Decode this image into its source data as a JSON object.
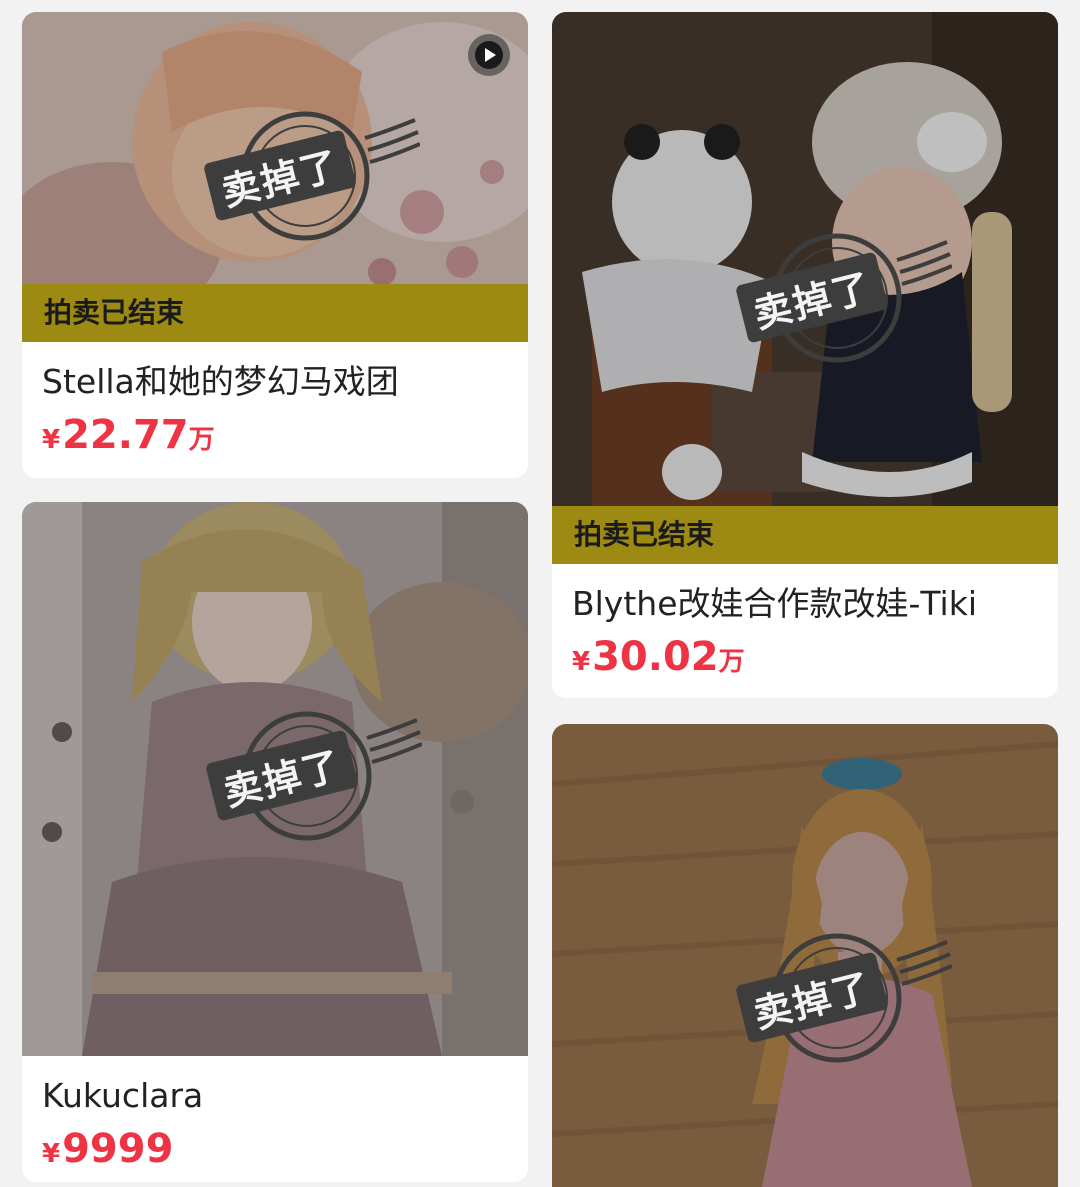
{
  "listings": [
    {
      "title": "Stella和她的梦幻马戏团",
      "currency": "¥",
      "price": "22.77",
      "unit": "万",
      "auction_status": "拍卖已结束",
      "sold_stamp": "卖掉了",
      "has_video": true,
      "image_tone": "#d9c2b6"
    },
    {
      "title": "Blythe改娃合作款改娃-Tiki",
      "currency": "¥",
      "price": "30.02",
      "unit": "万",
      "auction_status": "拍卖已结束",
      "sold_stamp": "卖掉了",
      "has_video": false,
      "image_tone": "#5b4a3e"
    },
    {
      "title": "Kukuclara",
      "currency": "¥",
      "price": "9999",
      "unit": "",
      "auction_status": "",
      "sold_stamp": "卖掉了",
      "has_video": false,
      "image_tone": "#b4a7a4"
    },
    {
      "title": "",
      "currency": "",
      "price": "",
      "unit": "",
      "auction_status": "",
      "sold_stamp": "卖掉了",
      "has_video": false,
      "image_tone": "#a67a52"
    }
  ],
  "colors": {
    "price": "#ee3344",
    "auction_bar": "#9c8a12",
    "card_bg": "#ffffff",
    "page_bg": "#f2f2f2"
  }
}
